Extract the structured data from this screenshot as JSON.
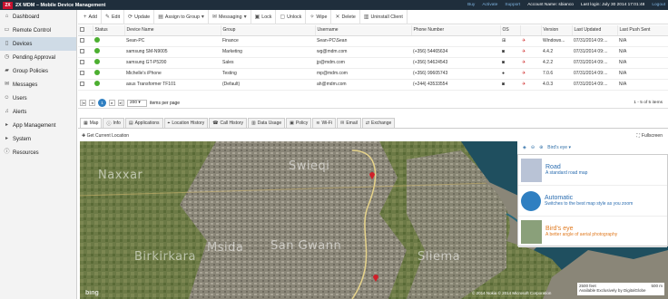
{
  "app": {
    "logo_mark": "2X",
    "title": "2X MDM – Mobile Device Management",
    "top_links": [
      "Buy",
      "Activate",
      "Support"
    ],
    "account_label": "Account Name: sbianco",
    "last_login": "Last login: July 30 2014 17:01:48",
    "logout": "Logout"
  },
  "sidebar": {
    "items": [
      {
        "label": "Dashboard",
        "icon": "home-icon",
        "glyph": "⌂",
        "active": false
      },
      {
        "label": "Remote Control",
        "icon": "monitor-icon",
        "glyph": "▭",
        "active": false
      },
      {
        "label": "Devices",
        "icon": "phone-icon",
        "glyph": "▯",
        "active": true
      },
      {
        "label": "Pending Approval",
        "icon": "clock-icon",
        "glyph": "◷",
        "active": false
      },
      {
        "label": "Group Policies",
        "icon": "folder-icon",
        "glyph": "▰",
        "active": false
      },
      {
        "label": "Messages",
        "icon": "envelope-icon",
        "glyph": "✉",
        "active": false
      },
      {
        "label": "Users",
        "icon": "user-icon",
        "glyph": "☺",
        "active": false
      },
      {
        "label": "Alerts",
        "icon": "bell-icon",
        "glyph": "♫",
        "active": false
      },
      {
        "label": "App Management",
        "icon": "apps-icon",
        "glyph": "▸",
        "active": false
      },
      {
        "label": "System",
        "icon": "gear-icon",
        "glyph": "▸",
        "active": false
      },
      {
        "label": "Resources",
        "icon": "info-icon",
        "glyph": "ⓘ",
        "active": false
      }
    ]
  },
  "toolbar": {
    "add": "Add",
    "edit": "Edit",
    "update": "Update",
    "assign": "Assign to Group",
    "messaging": "Messaging",
    "lock": "Lock",
    "unlock": "Unlock",
    "wipe": "Wipe",
    "delete": "Delete",
    "uninstall": "Uninstall Client"
  },
  "table": {
    "headers": [
      "Status",
      "Device Name",
      "Group",
      "Username",
      "Phone Number",
      "OS",
      "Version",
      "Last Updated",
      "Last Push Sent"
    ],
    "rows": [
      [
        "Sean-PC",
        "Finance",
        "Sean-PC\\Sean",
        "",
        "windows",
        "Windows...",
        "07/31/2014 09:...",
        "N/A"
      ],
      [
        "samsung SM-N9005",
        "Marketing",
        "wg@mdm.com",
        "(+356) 54465634",
        "android",
        "4.4.2",
        "07/31/2014 09:...",
        "N/A"
      ],
      [
        "samsung GT-P5200",
        "Sales",
        "jp@mdm.com",
        "(+356) 54624543",
        "android",
        "4.2.2",
        "07/31/2014 09:...",
        "N/A"
      ],
      [
        "Michelle's iPhone",
        "Testing",
        "mp@mdm.com",
        "(+356) 99605743",
        "apple",
        "7.0.6",
        "07/31/2014 09:...",
        "N/A"
      ],
      [
        "asus Transformer TF101",
        "(Default)",
        "ah@mdm.com",
        "(+244) 43533554",
        "android",
        "4.0.3",
        "07/31/2014 09:...",
        "N/A"
      ]
    ]
  },
  "pager": {
    "current_page": "1",
    "page_size": "200",
    "items_per_page": "items per page",
    "summary": "1 - 5 of 5 items"
  },
  "tabs": [
    "Map",
    "Info",
    "Applications",
    "Location History",
    "Call History",
    "Data Usage",
    "Policy",
    "Wi-Fi",
    "Email",
    "Exchange"
  ],
  "map": {
    "get_location": "Get Current Location",
    "fullscreen": "Fullscreen",
    "view_selected": "Bird's eye",
    "labels": [
      "Swieqi",
      "San Gwann",
      "Sliema",
      "Msida",
      "Naxxar",
      "Birkirkara"
    ],
    "options": [
      {
        "title": "Road",
        "desc": "A standard road map"
      },
      {
        "title": "Automatic",
        "desc": "Switches to the best map style as you zoom"
      },
      {
        "title": "Bird's eye",
        "desc": "A better angle of aerial photography"
      }
    ],
    "attribution": "© 2014 Nokia   © 2014 Microsoft Corporation",
    "scale_imperial": "2500 feet",
    "scale_metric": "500 m",
    "scale_note": "Available Exclusively by DigitalGlobe",
    "bing": "bing"
  },
  "colors": {
    "topbar": "#1f2e3c",
    "accent": "#2f7fc1",
    "status_online": "#4caf30",
    "pin": "#d0202a"
  }
}
